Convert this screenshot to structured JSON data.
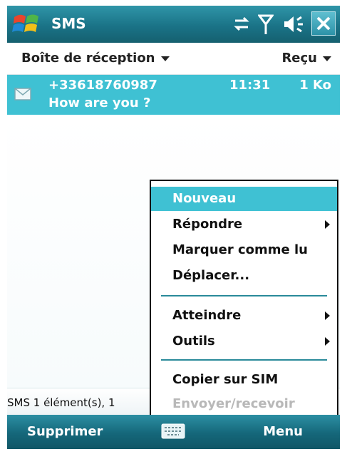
{
  "titlebar": {
    "title": "SMS",
    "icons": [
      "windows-start-icon",
      "connectivity-icon",
      "signal-icon",
      "volume-icon",
      "close-icon"
    ]
  },
  "header": {
    "folder": "Boîte de réception",
    "sort": "Reçu"
  },
  "messages": [
    {
      "from": "+33618760987",
      "time": "11:31",
      "size": "1 Ko",
      "preview": "How are you ?",
      "icon": "envelope-icon"
    }
  ],
  "status": {
    "text": "SMS  1 élément(s), 1"
  },
  "menu": {
    "items": [
      {
        "label": "Nouveau",
        "highlighted": true
      },
      {
        "label": "Répondre",
        "submenu": true
      },
      {
        "label": "Marquer comme lu"
      },
      {
        "label": "Déplacer..."
      },
      {
        "label": "Atteindre",
        "submenu": true
      },
      {
        "label": "Outils",
        "submenu": true
      },
      {
        "label": "Copier sur SIM"
      },
      {
        "label": "Envoyer/recevoir",
        "disabled": true
      }
    ]
  },
  "softkeys": {
    "left": "Supprimer",
    "right": "Menu",
    "center_icon": "keyboard-icon"
  },
  "colors": {
    "accent": "#3fc1d3",
    "bar": "#1a7387"
  }
}
